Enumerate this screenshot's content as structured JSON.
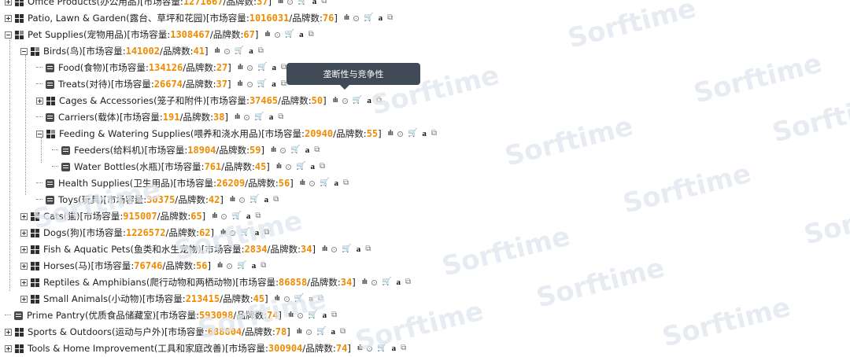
{
  "tooltip": "垄断性与竞争性",
  "watermark": "Sorftime",
  "format": {
    "market_label": "市场容量:",
    "brand_label": "/品牌数:"
  },
  "tools": {
    "bar": "ılı",
    "circle": "◎",
    "cart": "🛒",
    "a": "a",
    "copy": "⧉"
  },
  "rows": [
    {
      "name": "Office Products(办公用品)",
      "market": "1271667",
      "brands": "37",
      "toggle": "plus",
      "icon": "grid"
    },
    {
      "name": "Patio, Lawn & Garden(露台、草坪和花园)",
      "market": "1016031",
      "brands": "76",
      "toggle": "plus",
      "icon": "grid"
    },
    {
      "name": "Pet Supplies(宠物用品)",
      "market": "1308467",
      "brands": "67",
      "toggle": "minus",
      "icon": "grid-open"
    },
    {
      "name": "Birds(鸟)",
      "market": "141002",
      "brands": "41",
      "toggle": "minus",
      "icon": "grid-open"
    },
    {
      "name": "Food(食物)",
      "market": "134126",
      "brands": "27",
      "toggle": "line",
      "icon": "doc"
    },
    {
      "name": "Treats(对待)",
      "market": "26674",
      "brands": "37",
      "toggle": "line",
      "icon": "doc"
    },
    {
      "name": "Cages & Accessories(笼子和附件)",
      "market": "37465",
      "brands": "50",
      "toggle": "plus",
      "icon": "grid"
    },
    {
      "name": "Carriers(载体)",
      "market": "191",
      "brands": "38",
      "toggle": "line",
      "icon": "doc"
    },
    {
      "name": "Feeding & Watering Supplies(喂养和浇水用品)",
      "market": "20940",
      "brands": "55",
      "toggle": "minus",
      "icon": "grid-open"
    },
    {
      "name": "Feeders(给料机)",
      "market": "18904",
      "brands": "59",
      "toggle": "line",
      "icon": "doc"
    },
    {
      "name": "Water Bottles(水瓶)",
      "market": "761",
      "brands": "45",
      "toggle": "line",
      "icon": "doc"
    },
    {
      "name": "Health Supplies(卫生用品)",
      "market": "26209",
      "brands": "56",
      "toggle": "line",
      "icon": "doc"
    },
    {
      "name": "Toys(玩具)",
      "market": "30375",
      "brands": "42",
      "toggle": "line",
      "icon": "doc"
    },
    {
      "name": "Cats(猫)",
      "market": "915007",
      "brands": "65",
      "toggle": "plus",
      "icon": "grid"
    },
    {
      "name": "Dogs(狗)",
      "market": "1226572",
      "brands": "62",
      "toggle": "plus",
      "icon": "grid"
    },
    {
      "name": "Fish & Aquatic Pets(鱼类和水生宠物)",
      "market": "2834",
      "brands": "34",
      "toggle": "plus",
      "icon": "grid"
    },
    {
      "name": "Horses(马)",
      "market": "76746",
      "brands": "56",
      "toggle": "plus",
      "icon": "grid"
    },
    {
      "name": "Reptiles & Amphibians(爬行动物和两栖动物)",
      "market": "86858",
      "brands": "34",
      "toggle": "plus",
      "icon": "grid"
    },
    {
      "name": "Small Animals(小动物)",
      "market": "213415",
      "brands": "45",
      "toggle": "plus",
      "icon": "grid"
    },
    {
      "name": "Prime Pantry(优质食品储藏室)",
      "market": "593098",
      "brands": "74",
      "toggle": "line",
      "icon": "doc"
    },
    {
      "name": "Sports & Outdoors(运动与户外)",
      "market": "688804",
      "brands": "78",
      "toggle": "plus",
      "icon": "grid"
    },
    {
      "name": "Tools & Home Improvement(工具和家庭改善)",
      "market": "300904",
      "brands": "74",
      "toggle": "plus",
      "icon": "grid"
    }
  ]
}
